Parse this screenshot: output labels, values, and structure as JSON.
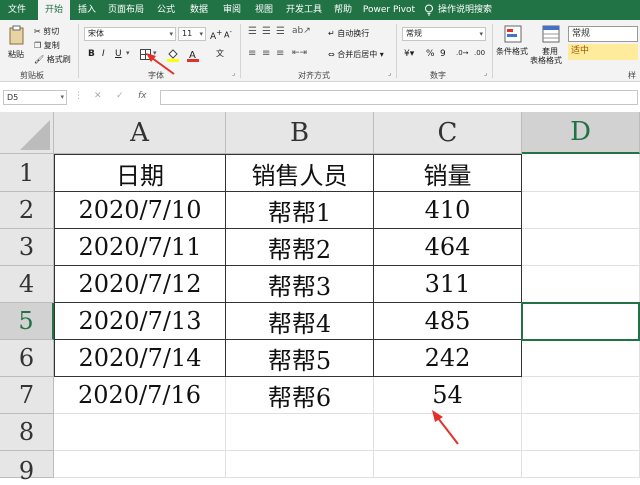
{
  "tabs": [
    {
      "label": "文件",
      "active": false
    },
    {
      "label": "开始",
      "active": true
    },
    {
      "label": "插入",
      "active": false
    },
    {
      "label": "页面布局",
      "active": false
    },
    {
      "label": "公式",
      "active": false
    },
    {
      "label": "数据",
      "active": false
    },
    {
      "label": "审阅",
      "active": false
    },
    {
      "label": "视图",
      "active": false
    },
    {
      "label": "开发工具",
      "active": false
    },
    {
      "label": "帮助",
      "active": false
    },
    {
      "label": "Power Pivot",
      "active": false
    }
  ],
  "tell_me": "操作说明搜索",
  "ribbon": {
    "clipboard": {
      "paste": "粘贴",
      "cut": "剪切",
      "copy": "复制",
      "format_painter": "格式刷",
      "label": "剪贴板"
    },
    "font": {
      "name": "宋体",
      "size": "11",
      "bold": "B",
      "italic": "I",
      "underline": "U",
      "label": "字体"
    },
    "alignment": {
      "wrap": "自动换行",
      "merge": "合并后居中",
      "label": "对齐方式"
    },
    "number": {
      "format": "常规",
      "percent": "%",
      "comma": "9",
      "label": "数字"
    },
    "styles": {
      "conditional": "条件格式",
      "table_format_1": "套用",
      "table_format_2": "表格格式",
      "normal": "常规",
      "good": "适中",
      "label": "样"
    }
  },
  "formula_bar": {
    "name_box": "D5",
    "cancel": "✕",
    "enter": "✓",
    "fx": "fx",
    "value": ""
  },
  "colors": {
    "excel_green": "#217346",
    "arrow_red": "#e0322b",
    "good_style_bg": "#ffeb9c",
    "good_style_fg": "#9c5700"
  },
  "sheet": {
    "columns": [
      "A",
      "B",
      "C",
      "D"
    ],
    "rows": [
      "1",
      "2",
      "3",
      "4",
      "5",
      "6",
      "7",
      "8",
      "9"
    ],
    "selected_column": "D",
    "selected_row": "5",
    "header": [
      "日期",
      "销售人员",
      "销量"
    ],
    "data": [
      [
        "2020/7/10",
        "帮帮1",
        "410"
      ],
      [
        "2020/7/11",
        "帮帮2",
        "464"
      ],
      [
        "2020/7/12",
        "帮帮3",
        "311"
      ],
      [
        "2020/7/13",
        "帮帮4",
        "485"
      ],
      [
        "2020/7/14",
        "帮帮5",
        "242"
      ],
      [
        "2020/7/16",
        "帮帮6",
        "54"
      ]
    ]
  }
}
